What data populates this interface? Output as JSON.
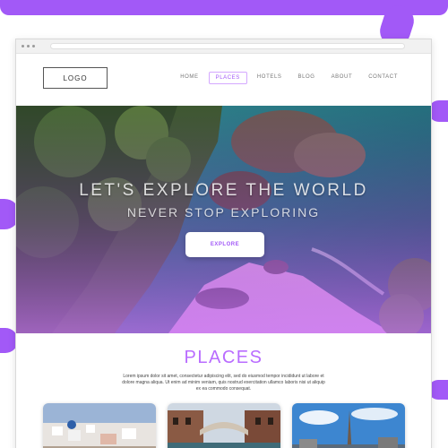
{
  "header": {
    "logo_label": "LOGO"
  },
  "nav": {
    "items": [
      {
        "label": "HOME",
        "active": false
      },
      {
        "label": "PLACES",
        "active": true
      },
      {
        "label": "HOTELS",
        "active": false
      },
      {
        "label": "BLOG",
        "active": false
      },
      {
        "label": "ABOUT",
        "active": false
      },
      {
        "label": "CONTACT",
        "active": false
      }
    ]
  },
  "hero": {
    "title": "LET'S EXPLORE THE WORLD",
    "subtitle": "NEVER STOP EXPLORING",
    "button_label": "EXPLORE"
  },
  "places": {
    "title": "PLACES",
    "description": "Lorem ipsum dolor sit amet, consectetur adipiscing elit, sed do eiusmod tempor incididunt ut labore et dolore magna aliqua. Ut enim ad minim veniam, quis nostrud exercitation ullamco laboris nisi ut aliquip ex ea commodo consequat."
  },
  "colors": {
    "accent": "#a259f7",
    "title_purple": "#b96cff"
  }
}
